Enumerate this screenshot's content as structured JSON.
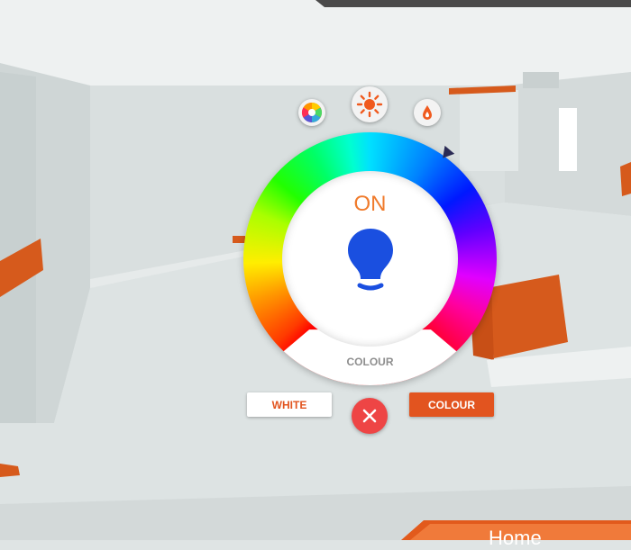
{
  "light": {
    "state": "ON",
    "mode_caption": "COLOUR",
    "bulb_color": "#1a4fe0",
    "accent_color": "#e2541f"
  },
  "mode_buttons": [
    {
      "name": "colour-wheel-icon"
    },
    {
      "name": "brightness-icon"
    },
    {
      "name": "temperature-drop-icon"
    }
  ],
  "actions": {
    "white_label": "WHITE",
    "colour_label": "COLOUR",
    "close_icon": "close-icon"
  },
  "nav": {
    "home_label": "Home"
  }
}
